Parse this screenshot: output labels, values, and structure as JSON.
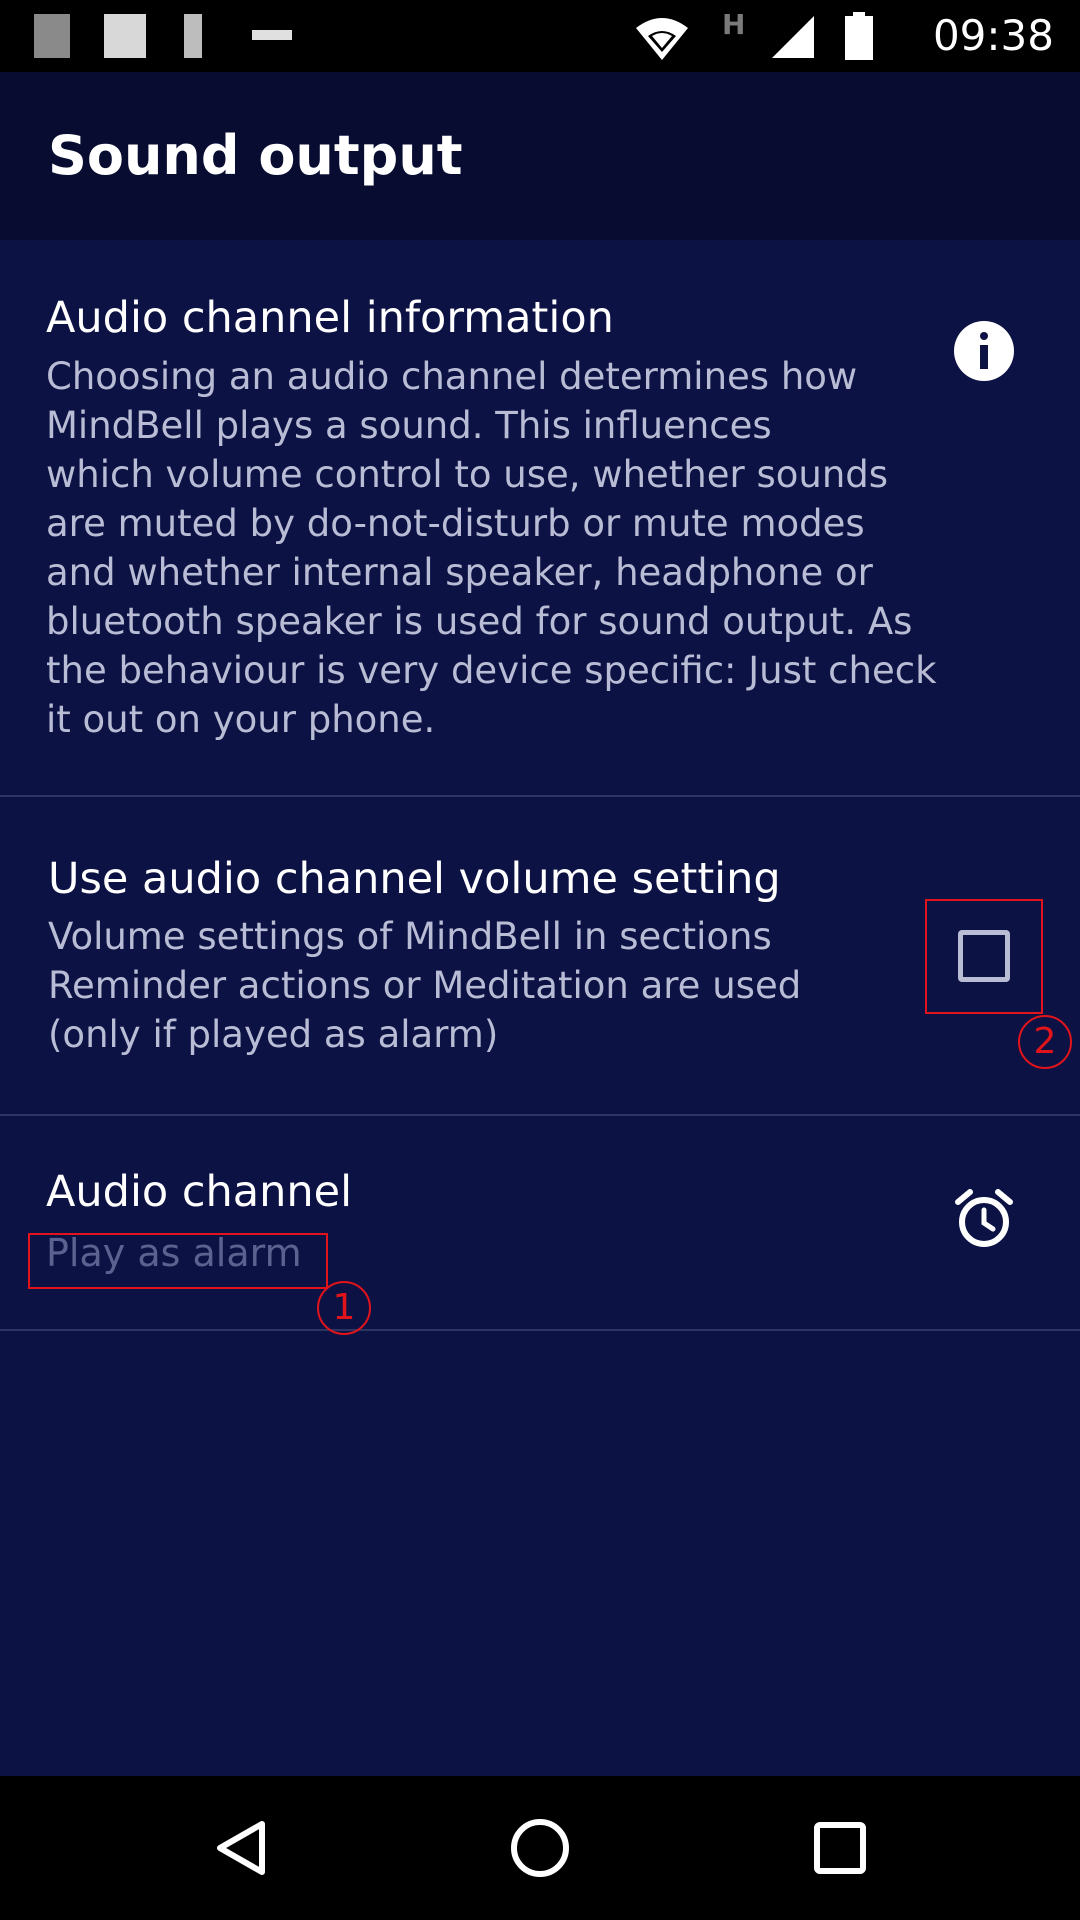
{
  "status_bar": {
    "clock": "09:38",
    "network_label": "H",
    "icons": [
      "notification-icon",
      "notification-icon",
      "notification-icon",
      "notification-icon",
      "wifi-icon",
      "signal-icon",
      "battery-icon"
    ]
  },
  "app_bar": {
    "title": "Sound output"
  },
  "preferences": [
    {
      "title": "Audio channel information",
      "summary": "Choosing an audio channel determines how MindBell plays a sound. This influences which volume control to use, whether sounds are muted by do-not-disturb or mute modes and whether internal speaker, headphone or bluetooth speaker is used for sound output. As the behaviour is very device specific: Just check it out on your phone.",
      "summary_lines": [
        "Choosing an audio channel determines how",
        "MindBell plays a sound. This influences",
        "which volume control to use, whether sounds",
        "are muted by do-not-disturb or mute modes",
        "and whether internal speaker, headphone or",
        "bluetooth speaker is used for sound output. As",
        "the behaviour is very device specific: Just check",
        "it out on your phone."
      ],
      "icon": "info-icon"
    },
    {
      "title": "Use audio channel volume setting",
      "summary_lines": [
        "Volume settings of MindBell in sections",
        "Reminder actions or Meditation are used",
        "(only if played as alarm)"
      ],
      "checked": false
    },
    {
      "title": "Audio channel",
      "summary": "Play as alarm",
      "icon": "alarm-clock-icon"
    }
  ],
  "annotations": [
    {
      "label": "1"
    },
    {
      "label": "2"
    }
  ],
  "nav_bar": {
    "icons": [
      "back-icon",
      "home-icon",
      "recents-icon"
    ]
  },
  "colors": {
    "app_bar": "#080c30",
    "background": "#0d1244",
    "annotation": "#e0141a",
    "summary_text": "#b8bcd4"
  }
}
